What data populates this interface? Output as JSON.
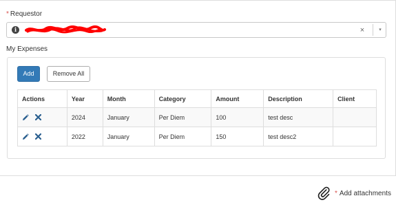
{
  "requestor": {
    "required_mark": "*",
    "label": "Requestor",
    "info_icon": "info-icon",
    "clear_icon": "×",
    "dropdown_icon": "▾"
  },
  "expenses": {
    "label": "My Expenses",
    "add_label": "Add",
    "remove_all_label": "Remove All",
    "columns": [
      "Actions",
      "Year",
      "Month",
      "Category",
      "Amount",
      "Description",
      "Client"
    ],
    "rows": [
      {
        "year": "2024",
        "month": "January",
        "category": "Per Diem",
        "amount": "100",
        "description": "test desc",
        "client": ""
      },
      {
        "year": "2022",
        "month": "January",
        "category": "Per Diem",
        "amount": "150",
        "description": "test desc2",
        "client": ""
      }
    ],
    "action_icons": [
      "edit-icon",
      "delete-icon"
    ]
  },
  "attachments": {
    "required_mark": "*",
    "label": "Add attachments",
    "icon": "paperclip-icon"
  },
  "colors": {
    "primary": "#337ab7",
    "required": "#d9534f",
    "action_icon": "#2a5f8f",
    "redaction": "#ff0000"
  }
}
